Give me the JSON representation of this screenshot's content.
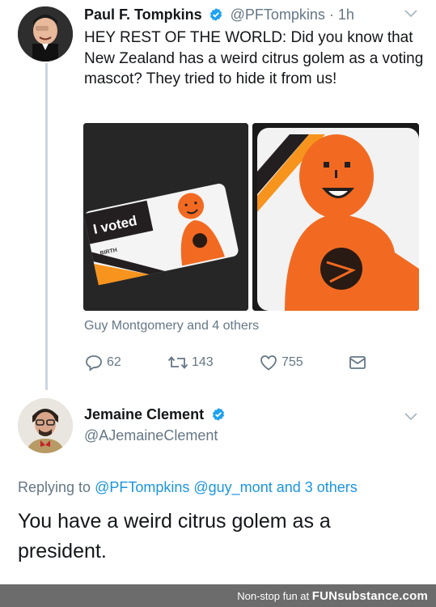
{
  "tweet1": {
    "name": "Paul F. Tompkins",
    "handle": "@PFTompkins · 1h",
    "text": "HEY REST OF THE WORLD: Did you know that New Zealand has a weird citrus golem as a voting mascot? They tried to hide it from us!",
    "media_sticker_text": "I voted",
    "media_sticker_small": "BIRTH",
    "media_credit": "Guy Montgomery and 4 others",
    "actions": {
      "reply_count": "62",
      "retweet_count": "143",
      "like_count": "755"
    }
  },
  "tweet2": {
    "name": "Jemaine Clement",
    "handle": "@AJemaineClement",
    "replying_prefix": "Replying to",
    "replying_to": "@PFTompkins @guy_mont and 3 others",
    "text": "You have a weird citrus golem as a president."
  },
  "footer": {
    "prefix": "Non-stop fun at",
    "brand": "FUNsubstance.com"
  },
  "colors": {
    "verified": "#1da1f2",
    "link": "#1b95e0",
    "secondary_text": "#657786",
    "golem_orange": "#f26a21"
  }
}
